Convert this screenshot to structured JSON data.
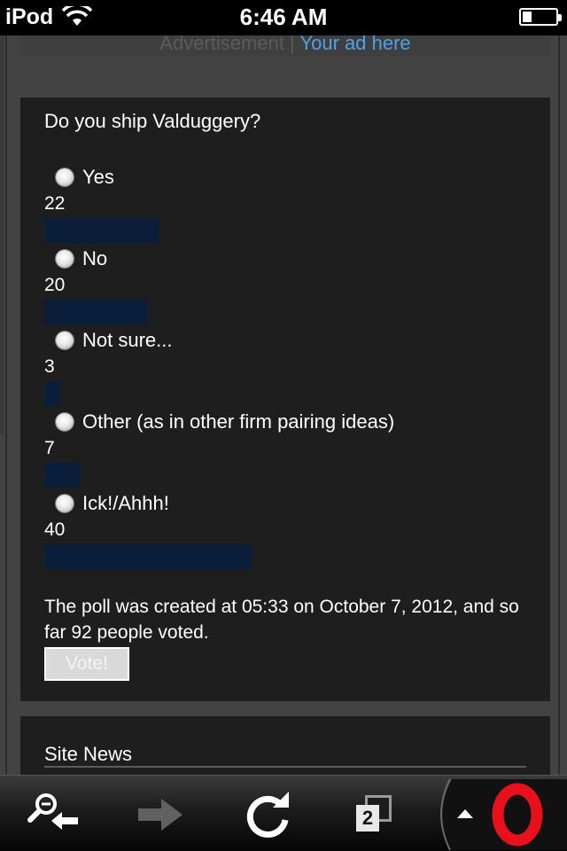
{
  "status_bar": {
    "carrier": "iPod",
    "time": "6:46 AM"
  },
  "ad_bar": {
    "label": "Advertisement",
    "separator": " | ",
    "link": "Your ad here"
  },
  "poll": {
    "question": "Do you ship Valduggery?",
    "options": [
      {
        "label": "Yes",
        "votes": "22",
        "share": 0.55
      },
      {
        "label": "No",
        "votes": "20",
        "share": 0.5
      },
      {
        "label": "Not sure...",
        "votes": "3",
        "share": 0.075
      },
      {
        "label": "Other (as in other firm pairing ideas)",
        "votes": "7",
        "share": 0.175
      },
      {
        "label": "Ick!/Ahhh!",
        "votes": "40",
        "share": 1.0
      }
    ],
    "footer": "The poll was created at 05:33 on October 7, 2012, and so far 92 people voted.",
    "vote_button": "Vote!",
    "bar_color": "#0b1e39"
  },
  "site_news": {
    "title": "Site News"
  },
  "toolbar": {
    "items": [
      "zoom-out-back-icon",
      "forward-arrow-icon",
      "reload-icon",
      "tabs-icon",
      "scroll-up-icon",
      "opera-logo-icon"
    ],
    "tab_count": "2"
  }
}
